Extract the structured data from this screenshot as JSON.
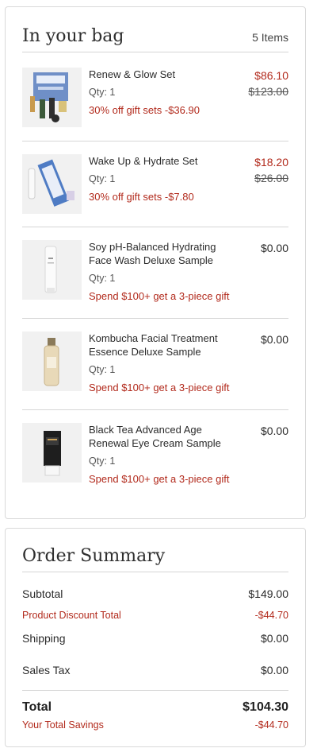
{
  "bag": {
    "title": "In your bag",
    "count": "5 Items",
    "items": [
      {
        "name": "Renew & Glow Set",
        "qty": "Qty: 1",
        "promo": "30% off gift sets -$36.90",
        "price": "$86.10",
        "original_price": "$123.00",
        "image": "gift-set-box"
      },
      {
        "name": "Wake Up & Hydrate Set",
        "qty": "Qty: 1",
        "promo": "30% off gift sets -$7.80",
        "price": "$18.20",
        "original_price": "$26.00",
        "image": "gift-set-tube-box"
      },
      {
        "name": "Soy pH-Balanced Hydrating Face Wash Deluxe Sample",
        "qty": "Qty: 1",
        "promo": "Spend $100+ get a 3-piece gift",
        "price": "$0.00",
        "image": "white-tube"
      },
      {
        "name": "Kombucha Facial Treatment Essence Deluxe Sample",
        "qty": "Qty: 1",
        "promo": "Spend $100+ get a 3-piece gift",
        "price": "$0.00",
        "image": "glass-bottle"
      },
      {
        "name": "Black Tea Advanced Age Renewal Eye Cream Sample",
        "qty": "Qty: 1",
        "promo": "Spend $100+ get a 3-piece gift",
        "price": "$0.00",
        "image": "black-tube"
      }
    ]
  },
  "summary": {
    "title": "Order Summary",
    "subtotal_label": "Subtotal",
    "subtotal": "$149.00",
    "discount_label": "Product Discount Total",
    "discount": "-$44.70",
    "shipping_label": "Shipping",
    "shipping": "$0.00",
    "tax_label": "Sales Tax",
    "tax": "$0.00",
    "total_label": "Total",
    "total": "$104.30",
    "savings_label": "Your Total Savings",
    "savings": "-$44.70"
  },
  "colors": {
    "accent_red": "#b22a1c",
    "text": "#2b2b2b",
    "border": "#d9d9d9"
  }
}
